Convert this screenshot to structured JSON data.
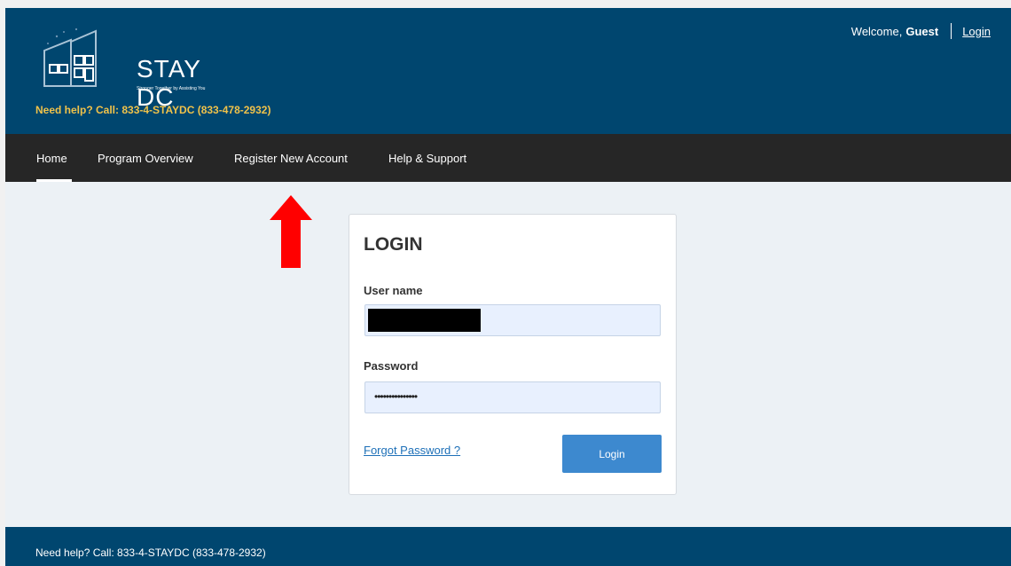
{
  "header": {
    "logo_text": "STAY DC",
    "logo_tagline": "Stronger Together by Assisting You",
    "help_text": "Need help? Call: 833-4-STAYDC (833-478-2932)",
    "welcome_prefix": "Welcome,",
    "welcome_user": "Guest",
    "login_link": "Login"
  },
  "nav": {
    "items": [
      {
        "label": "Home"
      },
      {
        "label": "Program Overview"
      },
      {
        "label": "Register New Account"
      },
      {
        "label": "Help & Support"
      }
    ],
    "active": "Home"
  },
  "login_card": {
    "title": "LOGIN",
    "username_label": "User name",
    "password_label": "Password",
    "password_masked": "•••••••••••••••",
    "forgot_link": "Forgot Password ?",
    "submit_label": "Login"
  },
  "footer": {
    "help_text": "Need help? Call: 833-4-STAYDC (833-478-2932)"
  },
  "colors": {
    "header_bg": "#00466f",
    "nav_bg": "#262626",
    "accent": "#3d89cf",
    "help_yellow": "#f0c24a",
    "annotation_arrow": "#ff0000"
  }
}
